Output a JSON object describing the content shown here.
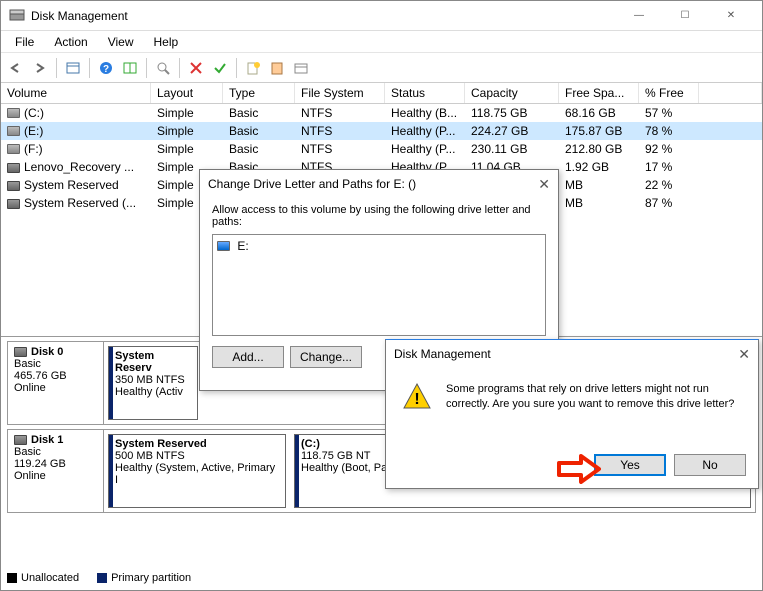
{
  "window": {
    "title": "Disk Management"
  },
  "menu": {
    "file": "File",
    "action": "Action",
    "view": "View",
    "help": "Help"
  },
  "columns": {
    "volume": "Volume",
    "layout": "Layout",
    "type": "Type",
    "fs": "File System",
    "status": "Status",
    "capacity": "Capacity",
    "free": "Free Spa...",
    "pct": "% Free"
  },
  "volumes": [
    {
      "name": "(C:)",
      "layout": "Simple",
      "type": "Basic",
      "fs": "NTFS",
      "status": "Healthy (B...",
      "cap": "118.75 GB",
      "free": "68.16 GB",
      "pct": "57 %"
    },
    {
      "name": "(E:)",
      "layout": "Simple",
      "type": "Basic",
      "fs": "NTFS",
      "status": "Healthy (P...",
      "cap": "224.27 GB",
      "free": "175.87 GB",
      "pct": "78 %"
    },
    {
      "name": "(F:)",
      "layout": "Simple",
      "type": "Basic",
      "fs": "NTFS",
      "status": "Healthy (P...",
      "cap": "230.11 GB",
      "free": "212.80 GB",
      "pct": "92 %"
    },
    {
      "name": "Lenovo_Recovery ...",
      "layout": "Simple",
      "type": "Basic",
      "fs": "NTFS",
      "status": "Healthy (P...",
      "cap": "11.04 GB",
      "free": "1.92 GB",
      "pct": "17 %"
    },
    {
      "name": "System Reserved",
      "layout": "Simple",
      "type": "",
      "fs": "",
      "status": "",
      "cap": "",
      "free": "MB",
      "pct": "22 %"
    },
    {
      "name": "System Reserved (...",
      "layout": "Simple",
      "type": "",
      "fs": "",
      "status": "",
      "cap": "",
      "free": "MB",
      "pct": "87 %"
    }
  ],
  "disks": [
    {
      "label": "Disk 0",
      "type": "Basic",
      "size": "465.76 GB",
      "status": "Online",
      "parts": [
        {
          "name": "System Reserv",
          "line2": "350 MB NTFS",
          "line3": "Healthy (Activ"
        }
      ]
    },
    {
      "label": "Disk 1",
      "type": "Basic",
      "size": "119.24 GB",
      "status": "Online",
      "parts": [
        {
          "name": "System Reserved",
          "line2": "500 MB NTFS",
          "line3": "Healthy (System, Active, Primary I"
        },
        {
          "name": "(C:)",
          "line2": "118.75 GB NT",
          "line3": "Healthy (Boot, Page File, Crash Dump, Primary Partition)"
        }
      ]
    }
  ],
  "legend": {
    "unalloc": "Unallocated",
    "primary": "Primary partition"
  },
  "change_dialog": {
    "title": "Change Drive Letter and Paths for E: ()",
    "prompt": "Allow access to this volume by using the following drive letter and paths:",
    "item": "E:",
    "add": "Add...",
    "change": "Change..."
  },
  "confirm_dialog": {
    "title": "Disk Management",
    "msg": "Some programs that rely on drive letters might not run correctly. Are you sure you want to remove this drive letter?",
    "yes": "Yes",
    "no": "No"
  }
}
